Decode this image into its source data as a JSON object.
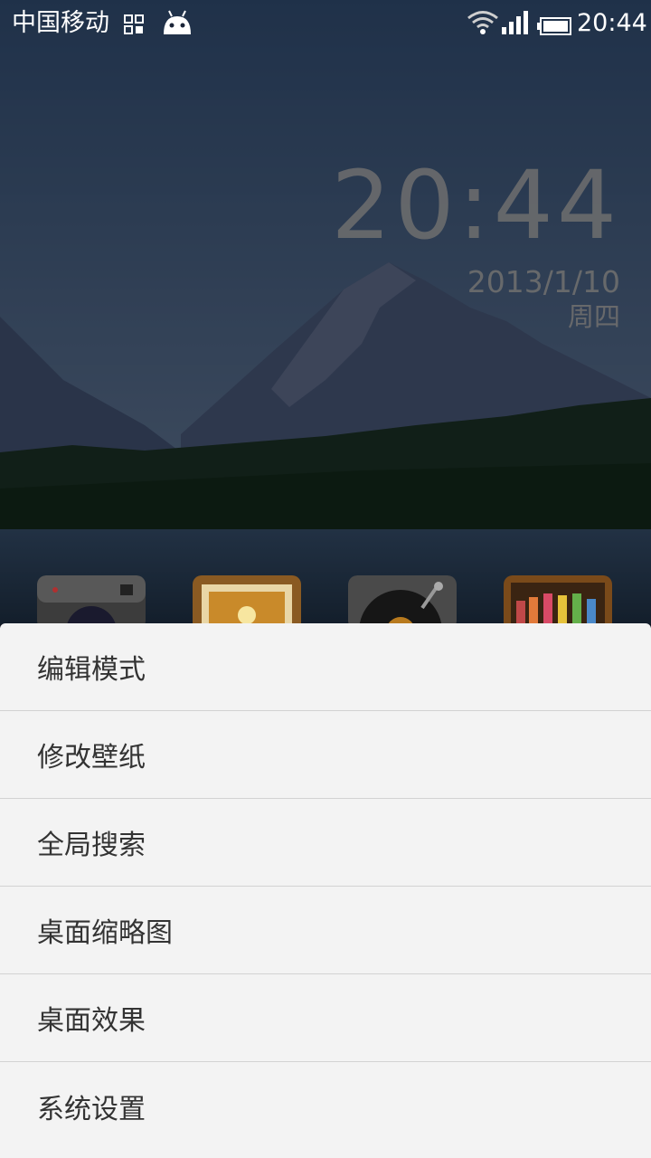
{
  "status_bar": {
    "carrier": "中国移动",
    "time": "20:44",
    "icons": [
      "qr-code-icon",
      "android-icon",
      "wifi-icon",
      "signal-icon",
      "battery-icon"
    ]
  },
  "clock_widget": {
    "time": "20:44",
    "date": "2013/1/10",
    "weekday": "周四"
  },
  "dock_icons": [
    "camera-icon",
    "gallery-icon",
    "music-icon",
    "theme-icon"
  ],
  "menu": {
    "items": [
      {
        "label": "编辑模式"
      },
      {
        "label": "修改壁纸"
      },
      {
        "label": "全局搜索"
      },
      {
        "label": "桌面缩略图"
      },
      {
        "label": "桌面效果"
      },
      {
        "label": "系统设置"
      }
    ]
  }
}
